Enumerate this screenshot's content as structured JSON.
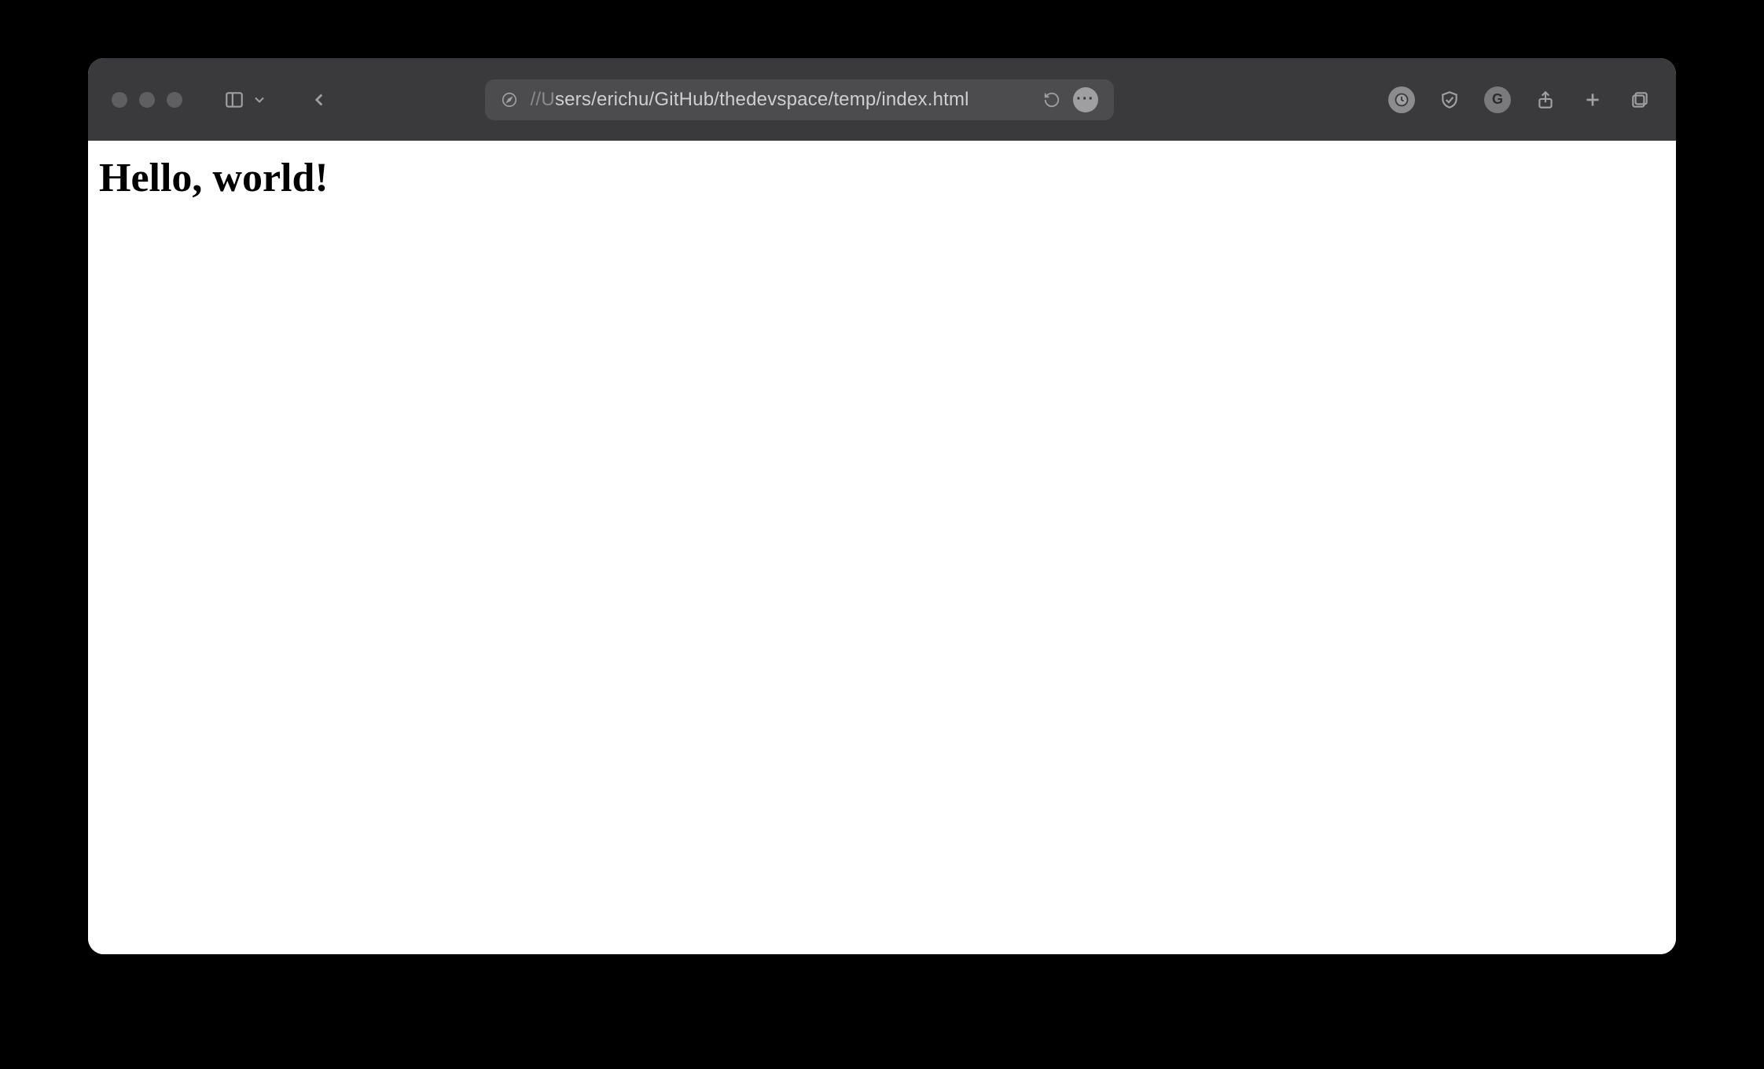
{
  "toolbar": {
    "url_prefix": "//U",
    "url_rest": "sers/erichu/GitHub/thedevspace/temp/index.html"
  },
  "page": {
    "heading": "Hello, world!"
  }
}
